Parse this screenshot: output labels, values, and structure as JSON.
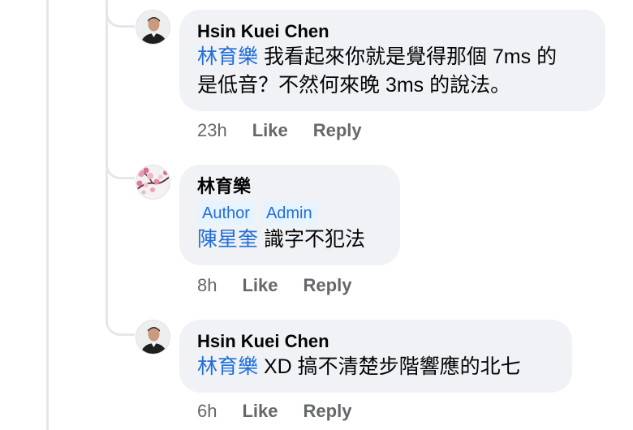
{
  "comments": [
    {
      "author": "Hsin Kuei Chen",
      "mention": "林育樂",
      "text_line1": " 我看起來你就是覺得那個 7ms 的",
      "text_line2": "是低音？不然何來晚 3ms 的說法。",
      "time": "23h",
      "like_label": "Like",
      "reply_label": "Reply"
    },
    {
      "author": "林育樂",
      "badges": [
        "Author",
        "Admin"
      ],
      "mention": "陳星奎",
      "text": " 識字不犯法",
      "time": "8h",
      "like_label": "Like",
      "reply_label": "Reply"
    },
    {
      "author": "Hsin Kuei Chen",
      "mention": "林育樂",
      "text": " XD 搞不清楚步階響應的北七",
      "time": "6h",
      "like_label": "Like",
      "reply_label": "Reply"
    }
  ]
}
